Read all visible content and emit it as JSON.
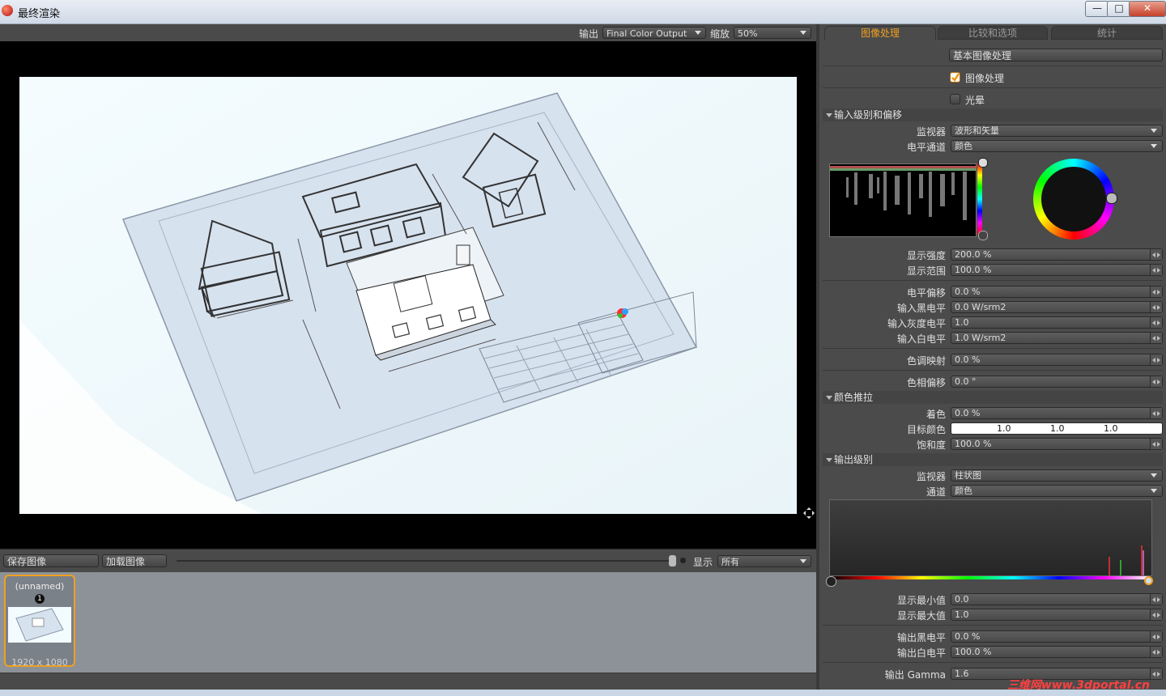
{
  "window": {
    "title": "最终渲染",
    "minimize": "—",
    "maximize": "□",
    "close": "✕"
  },
  "viewport_toolbar": {
    "output_label": "输出",
    "output_value": "Final Color Output",
    "zoom_label": "缩放",
    "zoom_value": "50%"
  },
  "bottom_toolbar": {
    "save_image": "保存图像",
    "load_image": "加载图像",
    "display_label": "显示",
    "display_value": "所有"
  },
  "thumbnail": {
    "name": "(unnamed)",
    "badge": "1",
    "size": "1920 x 1080"
  },
  "tabs": [
    "图像处理",
    "比较和选项",
    "统计"
  ],
  "panel": {
    "basic_button": "基本图像处理",
    "image_processing_check": "图像处理",
    "bloom_check": "光晕",
    "input_section": "输入级别和偏移",
    "monitor_label": "监视器",
    "monitor_value": "波形和矢量",
    "level_channel_label": "电平通道",
    "level_channel_value": "颜色",
    "display_intensity_label": "显示强度",
    "display_intensity_value": "200.0 %",
    "display_range_label": "显示范围",
    "display_range_value": "100.0 %",
    "level_offset_label": "电平偏移",
    "level_offset_value": "0.0 %",
    "input_black_label": "输入黑电平",
    "input_black_value": "0.0 W/srm2",
    "input_gray_label": "输入灰度电平",
    "input_gray_value": "1.0",
    "input_white_label": "输入白电平",
    "input_white_value": "1.0 W/srm2",
    "tone_map_label": "色调映射",
    "tone_map_value": "0.0 %",
    "hue_offset_label": "色相偏移",
    "hue_offset_value": "0.0 °",
    "color_push_section": "颜色推拉",
    "tint_label": "着色",
    "tint_value": "0.0 %",
    "target_color_label": "目标颜色",
    "target_color_r": "1.0",
    "target_color_g": "1.0",
    "target_color_b": "1.0",
    "saturation_label": "饱和度",
    "saturation_value": "100.0 %",
    "output_section": "输出级别",
    "out_monitor_label": "监视器",
    "out_monitor_value": "柱状图",
    "out_channel_label": "通道",
    "out_channel_value": "颜色",
    "display_min_label": "显示最小值",
    "display_min_value": "0.0",
    "display_max_label": "显示最大值",
    "display_max_value": "1.0",
    "output_black_label": "输出黑电平",
    "output_black_value": "0.0 %",
    "output_white_label": "输出白电平",
    "output_white_value": "100.0 %",
    "output_gamma_label": "输出 Gamma",
    "output_gamma_value": "1.6"
  },
  "watermark": "三维网www.3dportal.cn",
  "colors": {
    "accent": "#f0a020",
    "panel_bg": "#4b4b4b",
    "viewport_bg": "#000000"
  }
}
